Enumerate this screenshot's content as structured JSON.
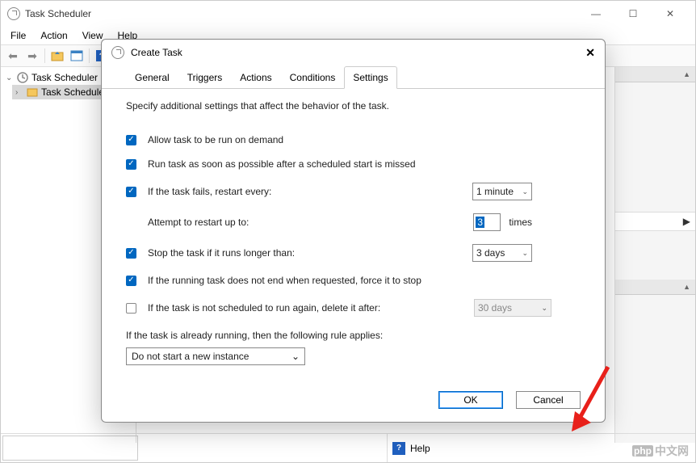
{
  "window": {
    "title": "Task Scheduler",
    "menu": [
      "File",
      "Action",
      "View",
      "Help"
    ]
  },
  "tree": {
    "root": "Task Scheduler (L",
    "child": "Task Schedule"
  },
  "dialog": {
    "title": "Create Task",
    "tabs": [
      "General",
      "Triggers",
      "Actions",
      "Conditions",
      "Settings"
    ],
    "active_tab": "Settings",
    "desc": "Specify additional settings that affect the behavior of the task.",
    "rows": {
      "allow_demand": "Allow task to be run on demand",
      "run_asap": "Run task as soon as possible after a scheduled start is missed",
      "if_fails": "If the task fails, restart every:",
      "restart_interval": "1 minute",
      "attempt_label": "Attempt to restart up to:",
      "attempt_value": "3",
      "attempt_times": "times",
      "stop_longer": "Stop the task if it runs longer than:",
      "stop_duration": "3 days",
      "force_stop": "If the running task does not end when requested, force it to stop",
      "delete_after": "If the task is not scheduled to run again, delete it after:",
      "delete_duration": "30 days",
      "running_rule": "If the task is already running, then the following rule applies:",
      "rule_value": "Do not start a new instance"
    },
    "buttons": {
      "ok": "OK",
      "cancel": "Cancel"
    }
  },
  "status": {
    "help": "Help"
  },
  "watermark": {
    "php": "php",
    "text": "中文网"
  }
}
